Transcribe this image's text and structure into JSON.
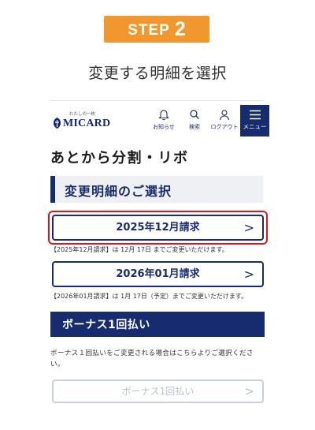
{
  "step": {
    "word": "STEP",
    "number": "2"
  },
  "caption": "変更する明細を選択",
  "header": {
    "logo_tagline": "わたしの一枚",
    "logo_text": "MICARD",
    "nav": [
      {
        "label": "お知らせ",
        "icon": "bell-icon"
      },
      {
        "label": "検索",
        "icon": "search-icon"
      },
      {
        "label": "ログアウト",
        "icon": "user-icon"
      }
    ],
    "menu_label": "メニュー"
  },
  "page_title": "あとから分割・リボ",
  "section_heading": "変更明細のご選択",
  "statements": [
    {
      "label": "2025年12月請求",
      "note": "【2025年12月請求】は 12月 17日 までご変更いただけます。",
      "highlighted": true
    },
    {
      "label": "2026年01月請求",
      "note": "【2026年01月請求】は 1月 17日（予定）までご変更いただけます。",
      "highlighted": false
    }
  ],
  "bonus": {
    "heading": "ボーナス1回払い",
    "description": "ボーナス１回払いをご変更される場合はこちらよりご選択ください。",
    "button_label": "ボーナス1回払い",
    "button_disabled": true
  },
  "colors": {
    "navy": "#172c6f",
    "orange": "#f0982e",
    "highlight_red": "#e3141b"
  }
}
